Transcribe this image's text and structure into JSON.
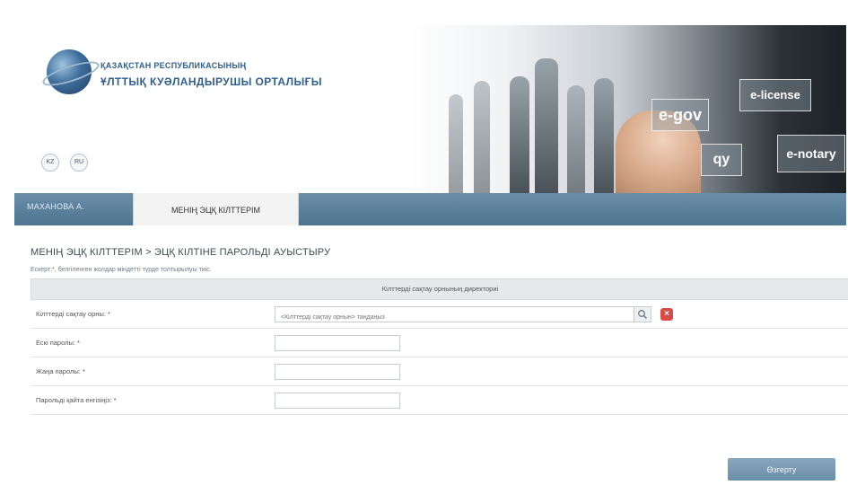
{
  "header": {
    "org_line1": "ҚАЗАҚСТАН РЕСПУБЛИКАСЫНЫҢ",
    "org_line2": "ҰЛТТЫҚ КУӘЛАНДЫРУШЫ ОРТАЛЫҒЫ",
    "lang_kz": "KZ",
    "lang_ru": "RU",
    "banner_badges": [
      "e-gov",
      "e-license",
      "e-notary",
      "qy"
    ]
  },
  "tabs": {
    "user": "МАХАНОВА А.",
    "active": "МЕНІҢ ЭЦҚ КІЛТТЕРІМ"
  },
  "page": {
    "title": "МЕНІҢ ЭЦҚ КІЛТТЕРІМ > ЭЦҚ КІЛТІНЕ ПАРОЛЬДІ АУЫСТЫРУ",
    "note": "Ескерт:*, белгіленген жолдар міндетті түрде толтырылуы тиіс."
  },
  "form": {
    "section_header": "Кілттерді сақтау орнының директориі",
    "rows": [
      {
        "label": "Кілттерді сақтау орны: *",
        "placeholder": "<Кілттерді сақтау орнын> таңдаңыз"
      },
      {
        "label": "Ескі паролы: *",
        "placeholder": ""
      },
      {
        "label": "Жаңа паролы: *",
        "placeholder": ""
      },
      {
        "label": "Парольді қайта енгізіңіз: *",
        "placeholder": ""
      }
    ],
    "submit_label": "Өзгерту"
  },
  "colors": {
    "tabbar": "#5a7f9a",
    "brand_text": "#2f5f8f",
    "delete": "#d84a46"
  }
}
